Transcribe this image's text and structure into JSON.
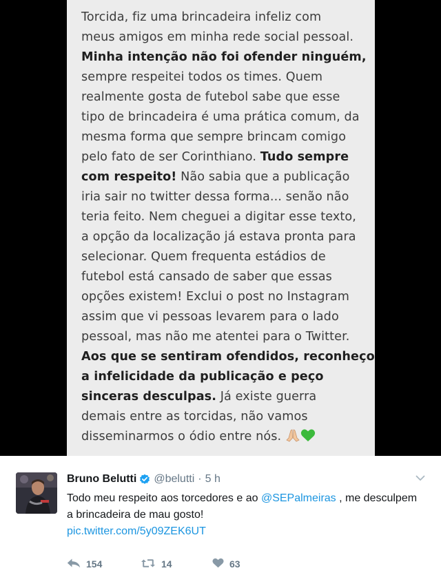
{
  "note": {
    "lines": [
      [
        {
          "t": "Torcida, fiz uma brincadeira infeliz com",
          "b": false
        }
      ],
      [
        {
          "t": "meus amigos em minha rede social pessoal.",
          "b": false
        }
      ],
      [
        {
          "t": "Minha intenção não foi ofender ninguém,",
          "b": true
        }
      ],
      [
        {
          "t": "sempre respeitei todos os times. Quem",
          "b": false
        }
      ],
      [
        {
          "t": "realmente gosta de futebol sabe que esse",
          "b": false
        }
      ],
      [
        {
          "t": "tipo de brincadeira é uma prática comum, da",
          "b": false
        }
      ],
      [
        {
          "t": "mesma forma que sempre brincam comigo",
          "b": false
        }
      ],
      [
        {
          "t": "pelo fato de ser Corinthiano. ",
          "b": false
        },
        {
          "t": "Tudo sempre",
          "b": true
        }
      ],
      [
        {
          "t": "com respeito!",
          "b": true
        },
        {
          "t": " Não sabia que a publicação",
          "b": false
        }
      ],
      [
        {
          "t": "iria sair no twitter dessa forma... senão não",
          "b": false
        }
      ],
      [
        {
          "t": "teria feito. Nem cheguei a digitar esse texto,",
          "b": false
        }
      ],
      [
        {
          "t": "a opção da localização já estava pronta para",
          "b": false
        }
      ],
      [
        {
          "t": "selecionar. Quem frequenta estádios de",
          "b": false
        }
      ],
      [
        {
          "t": "futebol está cansado de saber que essas",
          "b": false
        }
      ],
      [
        {
          "t": "opções existem! Exclui o post no Instagram",
          "b": false
        }
      ],
      [
        {
          "t": "assim que vi pessoas levarem para o lado",
          "b": false
        }
      ],
      [
        {
          "t": "pessoal, mas não me atentei para o Twitter.",
          "b": false
        }
      ],
      [
        {
          "t": "Aos que se sentiram ofendidos, reconheço",
          "b": true
        }
      ],
      [
        {
          "t": "a infelicidade da publicação e peço",
          "b": true
        }
      ],
      [
        {
          "t": "sinceras desculpas.",
          "b": true
        },
        {
          "t": " Já existe guerra",
          "b": false
        }
      ],
      [
        {
          "t": "demais entre as torcidas, não vamos",
          "b": false
        }
      ],
      [
        {
          "t": "disseminarmos o ódio entre nós. ",
          "b": false
        }
      ]
    ],
    "trailing_emoji": [
      "praying-hands-icon",
      "green-heart-icon"
    ]
  },
  "tweet": {
    "name": "Bruno Belutti",
    "handle": "@belutti",
    "separator": "·",
    "time": "5 h",
    "text_before": "Todo meu respeito aos torcedores e ao ",
    "mention": "@SEPalmeiras",
    "text_after": " , me desculpem a brincadeira de mau gosto!",
    "link": "pic.twitter.com/5y09ZEK6UT",
    "verified_icon": "verified-badge-icon",
    "caret_icon": "chevron-down-icon"
  },
  "actions": {
    "reply": {
      "icon": "reply-icon",
      "count": "154"
    },
    "retweet": {
      "icon": "retweet-icon",
      "count": "14"
    },
    "like": {
      "icon": "heart-icon",
      "count": "63"
    }
  },
  "colors": {
    "link": "#1b95e0",
    "verified": "#1da1f2",
    "muted": "#657786",
    "note_bg": "#ececec"
  }
}
